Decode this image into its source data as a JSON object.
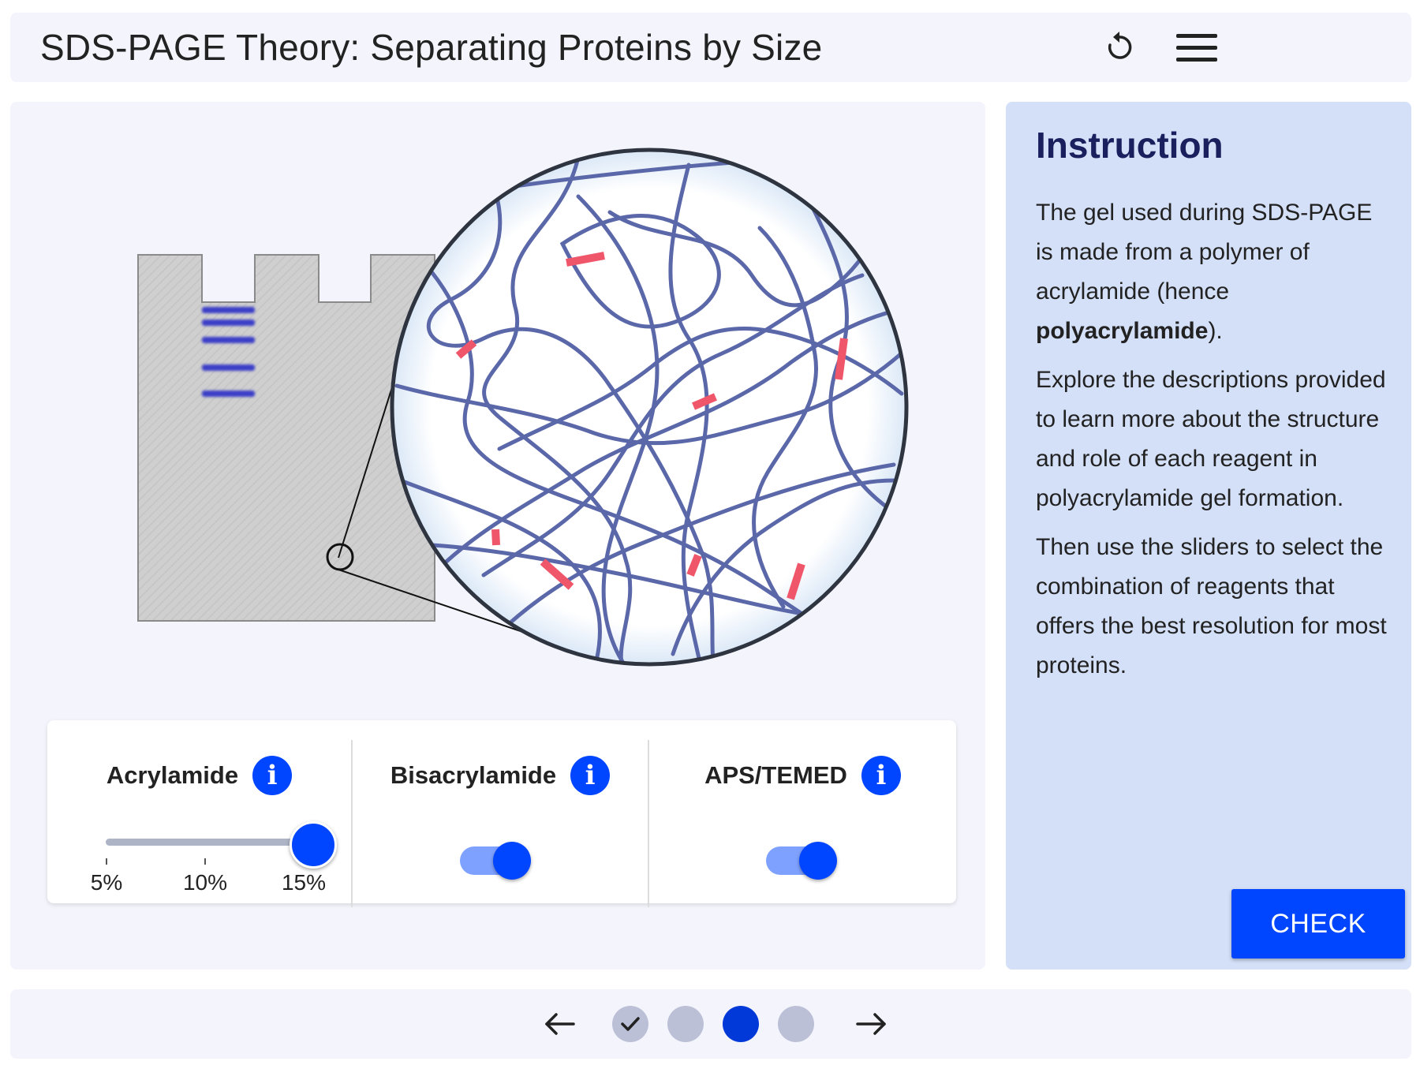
{
  "header": {
    "title": "SDS-PAGE Theory: Separating Proteins by Size",
    "reset_icon": "reset-icon",
    "menu_icon": "hamburger-menu-icon"
  },
  "controls": {
    "acrylamide": {
      "label": "Acrylamide",
      "ticks": [
        "5%",
        "10%",
        "15%"
      ],
      "value": "15%"
    },
    "bisacrylamide": {
      "label": "Bisacrylamide",
      "state": "on"
    },
    "aps_temed": {
      "label": "APS/TEMED",
      "state": "on"
    },
    "info_icon": "info-icon"
  },
  "instruction": {
    "heading": "Instruction",
    "p1_before": "The gel used during SDS-PAGE is made from a polymer of acrylamide (hence ",
    "p1_bold": "polyacrylamide",
    "p1_after": ").",
    "p2": "Explore the descriptions provided to learn more about the structure and role of each reagent in polyacrylamide gel formation.",
    "p3": "Then use the sliders to select the combination of reagents that offers the best resolution for most proteins.",
    "check_label": "CHECK"
  },
  "footer": {
    "pages": [
      {
        "state": "completed"
      },
      {
        "state": "inactive"
      },
      {
        "state": "current"
      },
      {
        "state": "inactive"
      }
    ]
  },
  "colors": {
    "accent": "#0045ff",
    "polymer": "#5a67a8",
    "crosslink": "#f0566a",
    "band": "#3a3ec8",
    "instruction_bg": "#d4e0f8",
    "panel_bg": "#f4f5fc"
  }
}
